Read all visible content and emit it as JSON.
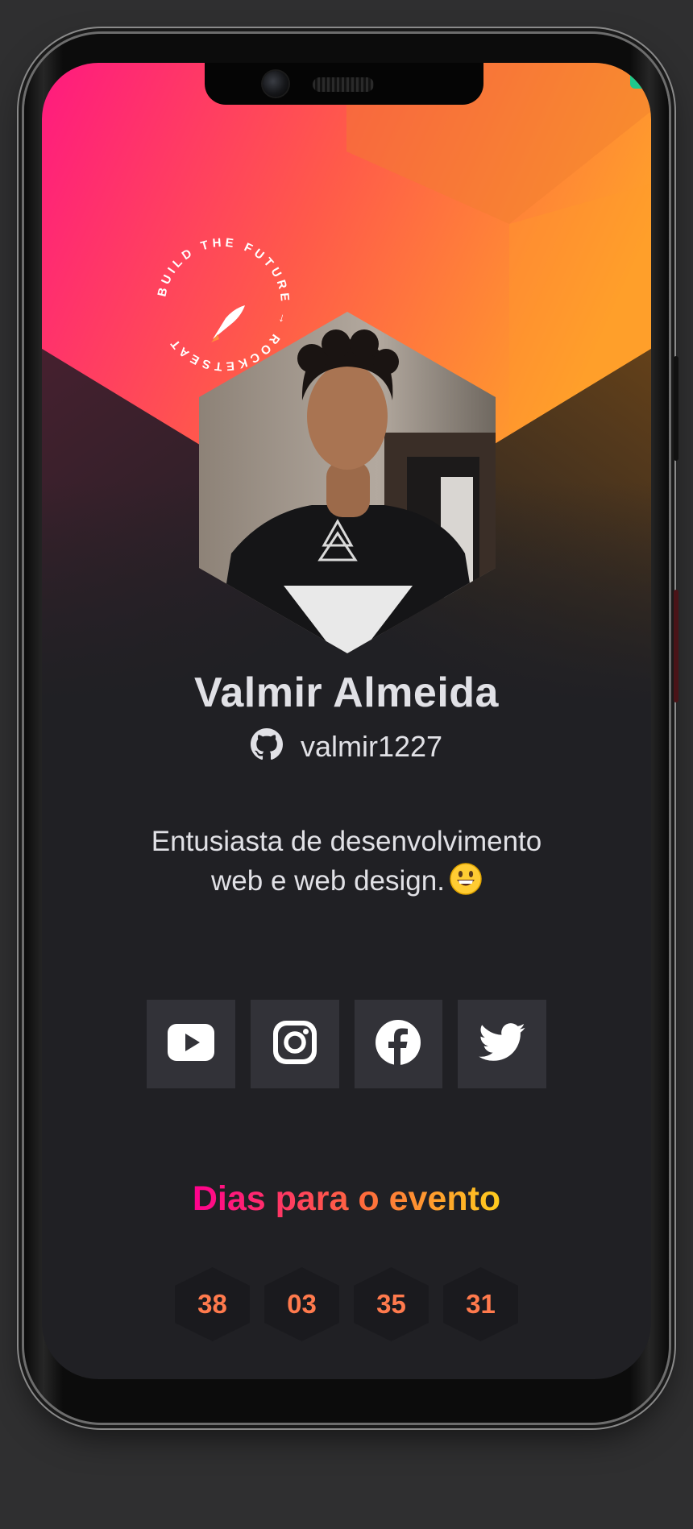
{
  "profile": {
    "name": "Valmir Almeida",
    "github_user": "valmir1227",
    "bio_line1": "Entusiasta de desenvolvimento",
    "bio_line2": "web e web design.",
    "bio_emoji": "😃"
  },
  "stamp": {
    "text": "BUILD THE FUTURE → ROCKETSEAT"
  },
  "socials": [
    {
      "name": "youtube-icon"
    },
    {
      "name": "instagram-icon"
    },
    {
      "name": "facebook-icon"
    },
    {
      "name": "twitter-icon"
    }
  ],
  "countdown": {
    "title": "Dias para o evento",
    "values": [
      "38",
      "03",
      "35",
      "31"
    ]
  },
  "colors": {
    "background": "#202024",
    "card": "#323238",
    "text": "#e1e1e6",
    "gradient_start": "#ff008e",
    "gradient_mid": "#ff6a3d",
    "gradient_end": "#ffcd1e"
  }
}
